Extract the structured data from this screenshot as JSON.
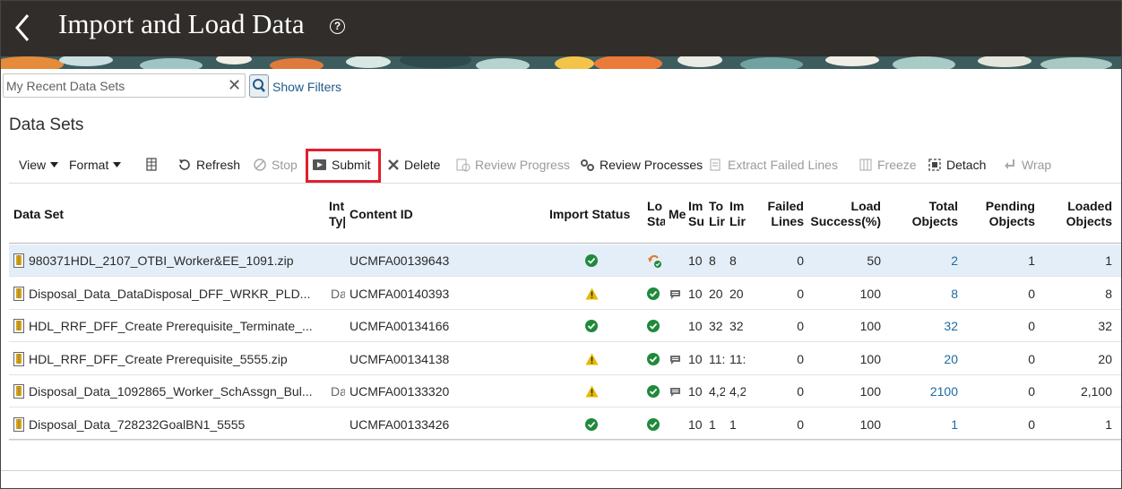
{
  "header": {
    "title": "Import and Load Data",
    "help": "?"
  },
  "search": {
    "placeholder": "My Recent Data Sets",
    "value": "",
    "show_filters": "Show Filters"
  },
  "section_title": "Data Sets",
  "toolbar": {
    "view": "View",
    "format": "Format",
    "refresh": "Refresh",
    "stop": "Stop",
    "submit": "Submit",
    "delete": "Delete",
    "review_progress": "Review Progress",
    "review_processes": "Review Processes",
    "extract_failed_lines": "Extract Failed Lines",
    "freeze": "Freeze",
    "detach": "Detach",
    "wrap": "Wrap"
  },
  "columns": {
    "data_set": "Data Set",
    "int_type_1": "Int",
    "int_type_2": "Ty|",
    "content_id": "Content ID",
    "import_status": "Import Status",
    "load_status_1": "Lo",
    "load_status_2": "Sta",
    "messages": "Me",
    "imported_1": "Im",
    "imported_2": "Su",
    "total_lines_1": "To",
    "total_lines_2": "Lir",
    "imported_lines_1": "Im",
    "imported_lines_2": "Lir",
    "failed_lines_1": "Failed",
    "failed_lines_2": "Lines",
    "load_success_1": "Load",
    "load_success_2": "Success(%)",
    "total_objects_1": "Total",
    "total_objects_2": "Objects",
    "pending_objects_1": "Pending",
    "pending_objects_2": "Objects",
    "loaded_objects_1": "Loaded",
    "loaded_objects_2": "Objects"
  },
  "rows": [
    {
      "data_set": "980371HDL_2107_OTBI_Worker&EE_1091.zip",
      "int_type": "",
      "content_id": "UCMFA00139643",
      "import_status": "success",
      "load_status": "in-progress",
      "has_message": false,
      "imported": "10",
      "total_lines": "8",
      "imported_lines": "8",
      "failed_lines": "0",
      "load_success": "50",
      "total_objects": "2",
      "pending_objects": "1",
      "loaded_objects": "1"
    },
    {
      "data_set": "Disposal_Data_DataDisposal_DFF_WRKR_PLD...",
      "int_type": "Da",
      "content_id": "UCMFA00140393",
      "import_status": "warning",
      "load_status": "success",
      "has_message": true,
      "imported": "10",
      "total_lines": "20",
      "imported_lines": "20",
      "failed_lines": "0",
      "load_success": "100",
      "total_objects": "8",
      "pending_objects": "0",
      "loaded_objects": "8"
    },
    {
      "data_set": "HDL_RRF_DFF_Create Prerequisite_Terminate_...",
      "int_type": "",
      "content_id": "UCMFA00134166",
      "import_status": "success",
      "load_status": "success",
      "has_message": false,
      "imported": "10",
      "total_lines": "32",
      "imported_lines": "32",
      "failed_lines": "0",
      "load_success": "100",
      "total_objects": "32",
      "pending_objects": "0",
      "loaded_objects": "32"
    },
    {
      "data_set": "HDL_RRF_DFF_Create Prerequisite_5555.zip",
      "int_type": "",
      "content_id": "UCMFA00134138",
      "import_status": "warning",
      "load_status": "success",
      "has_message": true,
      "imported": "10",
      "total_lines": "11:",
      "imported_lines": "11:",
      "failed_lines": "0",
      "load_success": "100",
      "total_objects": "20",
      "pending_objects": "0",
      "loaded_objects": "20"
    },
    {
      "data_set": "Disposal_Data_1092865_Worker_SchAssgn_Bul...",
      "int_type": "Da",
      "content_id": "UCMFA00133320",
      "import_status": "warning",
      "load_status": "success",
      "has_message": true,
      "imported": "10",
      "total_lines": "4,2",
      "imported_lines": "4,2",
      "failed_lines": "0",
      "load_success": "100",
      "total_objects": "2100",
      "pending_objects": "0",
      "loaded_objects": "2,100"
    },
    {
      "data_set": "Disposal_Data_728232GoalBN1_5555",
      "int_type": "",
      "content_id": "UCMFA00133426",
      "import_status": "success",
      "load_status": "success",
      "has_message": false,
      "imported": "10",
      "total_lines": "1",
      "imported_lines": "1",
      "failed_lines": "0",
      "load_success": "100",
      "total_objects": "1",
      "pending_objects": "0",
      "loaded_objects": "1"
    }
  ],
  "colors": {
    "header_bg": "#312d2a",
    "link": "#1e6aa2",
    "success": "#1f8a3b",
    "warning": "#e6b800",
    "highlight": "#e0202e"
  }
}
